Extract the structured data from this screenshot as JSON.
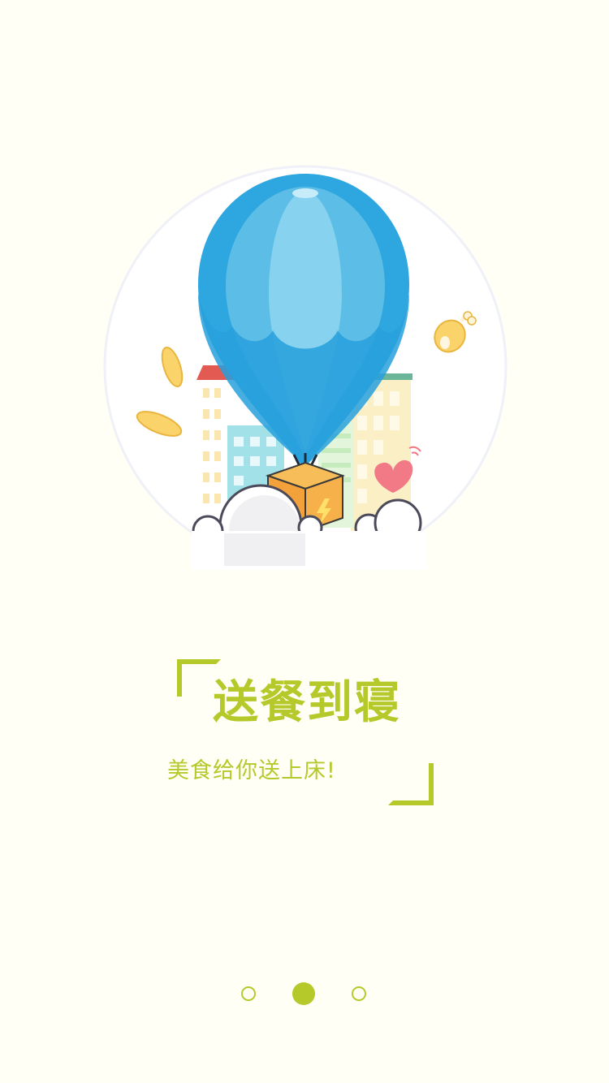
{
  "onboarding": {
    "title": "送餐到寝",
    "subtitle": "美食给你送上床!",
    "page_indicator": {
      "total_pages": 3,
      "current_page": 2
    }
  },
  "colors": {
    "background": "#fffff5",
    "accent": "#b5c92a",
    "balloon": "#2ea6df",
    "box": "#f3a13a",
    "heart": "#f27a86"
  },
  "icons": {
    "illustration": "hot-air-balloon-delivery-illustration"
  }
}
